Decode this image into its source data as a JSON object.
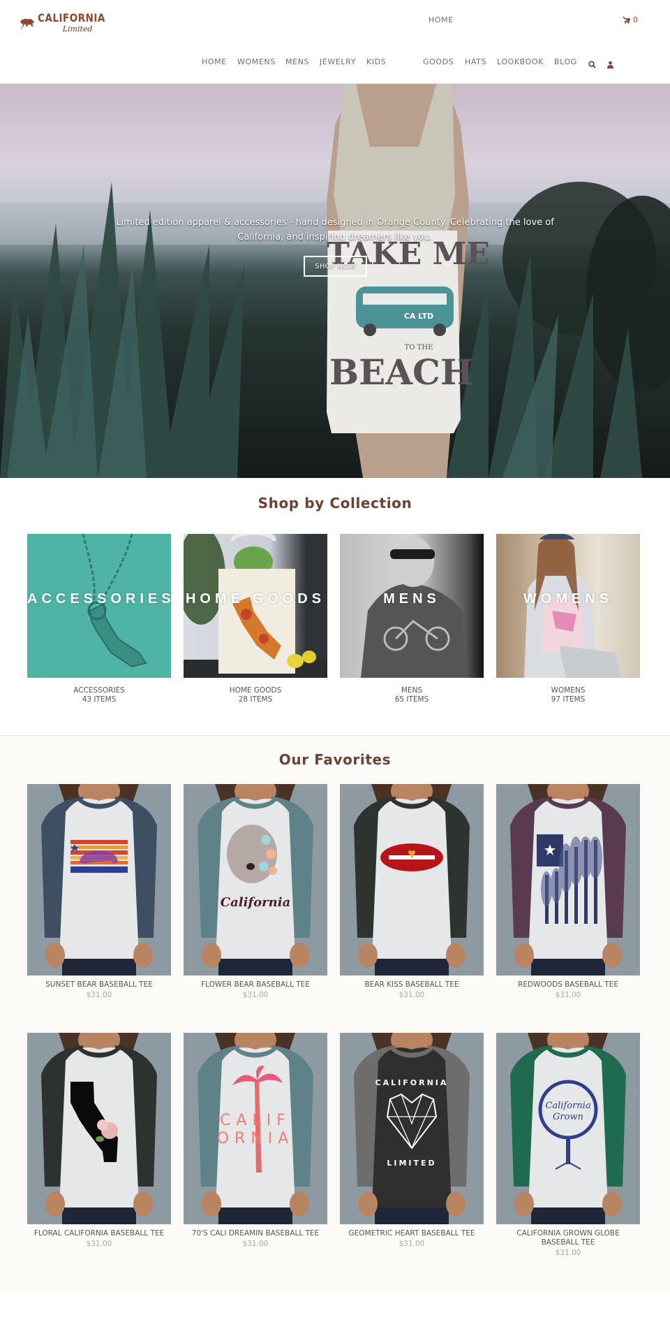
{
  "brand": {
    "name": "CALIFORNIA",
    "tagline": "Limited",
    "color": "#8b4a2f"
  },
  "header": {
    "top_link": "HOME",
    "cart": {
      "icon": "cart-icon",
      "count": "0"
    },
    "nav": [
      {
        "label": "HOME"
      },
      {
        "label": "WOMENS"
      },
      {
        "label": "MENS"
      },
      {
        "label": "JEWELRY"
      },
      {
        "label": "KIDS"
      },
      {
        "label": "GOODS"
      },
      {
        "label": "HATS"
      },
      {
        "label": "LOOKBOOK"
      },
      {
        "label": "BLOG"
      }
    ],
    "icons": {
      "search": "search-icon",
      "account": "user-icon"
    }
  },
  "hero": {
    "text": "Limited edition apparel & accessories - hand designed in Orange County. Celebrating the love of California, and inspiring dreamers like you.",
    "button": "SHOP NOW",
    "shirt_print": {
      "line1": "TAKE ME",
      "badge": "CA LTD",
      "line2": "TO THE",
      "line3": "BEACH"
    }
  },
  "collections": {
    "title": "Shop by Collection",
    "items": [
      {
        "overlay": "ACCESSORIES",
        "name": "ACCESSORIES",
        "count": "43 ITEMS"
      },
      {
        "overlay": "HOME GOODS",
        "name": "HOME GOODS",
        "count": "28 ITEMS"
      },
      {
        "overlay": "MENS",
        "name": "MENS",
        "count": "65 ITEMS"
      },
      {
        "overlay": "WOMENS",
        "name": "WOMENS",
        "count": "97 ITEMS"
      }
    ]
  },
  "favorites": {
    "title": "Our Favorites",
    "products": [
      {
        "name": "SUNSET BEAR BASEBALL TEE",
        "price": "$31.00",
        "sleeve": "#3e4f63"
      },
      {
        "name": "FLOWER BEAR BASEBALL TEE",
        "price": "$31.00",
        "sleeve": "#5f8289",
        "print": "California"
      },
      {
        "name": "BEAR KISS BASEBALL TEE",
        "price": "$31.00",
        "sleeve": "#2f3330"
      },
      {
        "name": "REDWOODS BASEBALL TEE",
        "price": "$31.00",
        "sleeve": "#5a3a4e"
      },
      {
        "name": "FLORAL CALIFORNIA BASEBALL TEE",
        "price": "$31.00",
        "sleeve": "#2e322f"
      },
      {
        "name": "70'S CALI DREAMIN BASEBALL TEE",
        "price": "$31.00",
        "sleeve": "#5f8289",
        "print": "CALIF ORNIA"
      },
      {
        "name": "GEOMETRIC HEART BASEBALL TEE",
        "price": "$31.00",
        "sleeve": "#6f6c6c",
        "print_top": "CALIFORNIA",
        "print_bottom": "LIMITED"
      },
      {
        "name": "CALIFORNIA GROWN GLOBE BASEBALL TEE",
        "price": "$31.00",
        "sleeve": "#1f6b4f",
        "print": "California Grown"
      }
    ]
  }
}
